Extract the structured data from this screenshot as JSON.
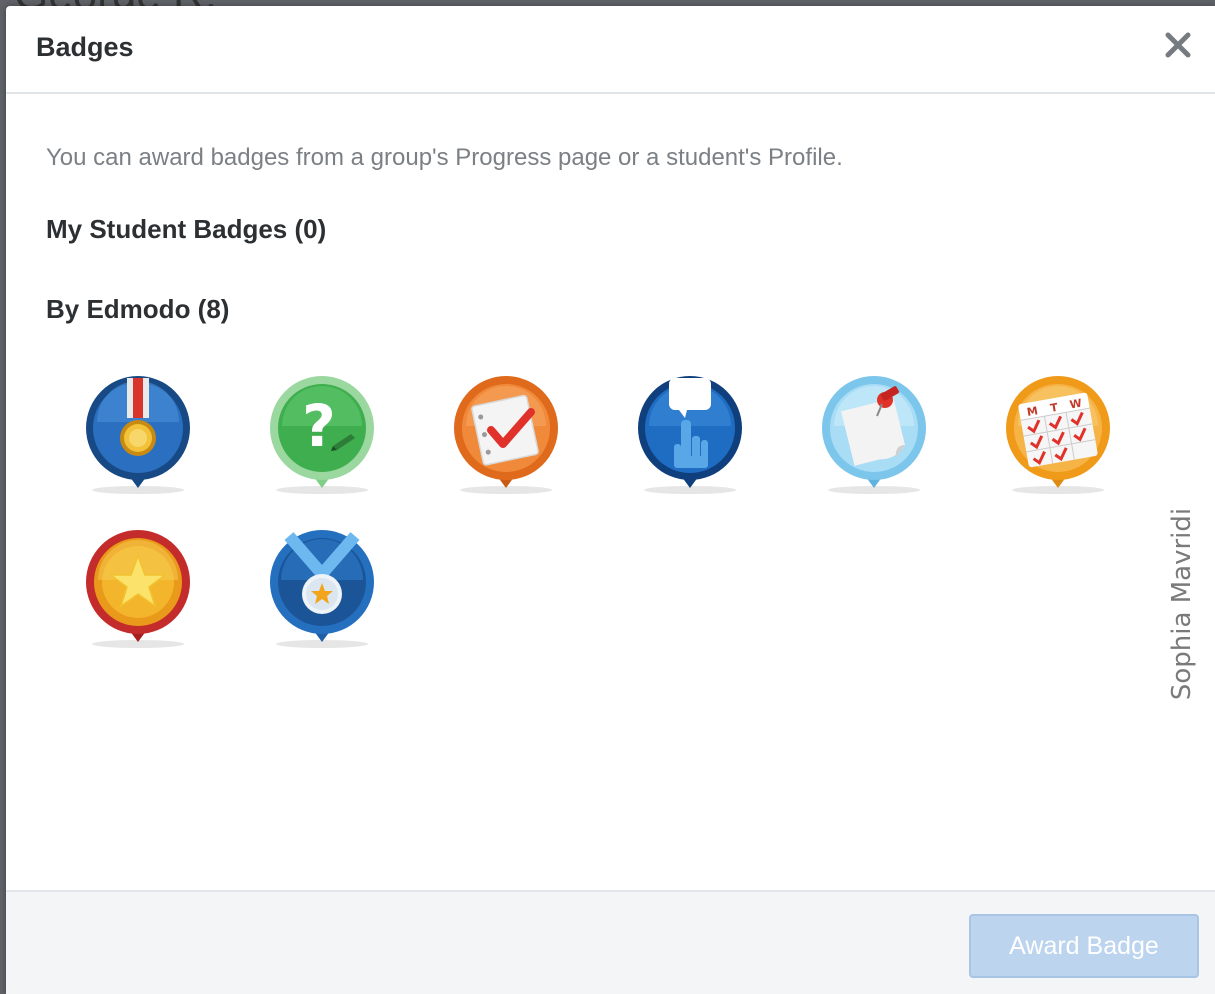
{
  "background_title": "George R.",
  "modal": {
    "title": "Badges",
    "close_icon": "close-icon",
    "intro_text": "You can award badges from a group's Progress page or a student's Profile.",
    "sections": [
      {
        "heading": "My Student Badges (0)"
      },
      {
        "heading": "By Edmodo (8)"
      }
    ],
    "badges": [
      {
        "icon": "medal-ribbon-badge-icon",
        "color": "#1f5fa8"
      },
      {
        "icon": "question-mark-badge-icon",
        "color": "#4cbb5a"
      },
      {
        "icon": "checklist-badge-icon",
        "color": "#e8711f"
      },
      {
        "icon": "raised-hand-badge-icon",
        "color": "#1b63b3"
      },
      {
        "icon": "pinned-note-badge-icon",
        "color": "#6cc0ea"
      },
      {
        "icon": "calendar-badge-icon",
        "color": "#f3a11b"
      },
      {
        "icon": "star-badge-icon",
        "color": "#c42b2b"
      },
      {
        "icon": "star-medal-badge-icon",
        "color": "#2470bf"
      }
    ],
    "calendar_days": [
      "M",
      "T",
      "W"
    ],
    "footer": {
      "award_button_label": "Award Badge",
      "award_button_color": "#bcd4ee"
    }
  },
  "watermark": "Sophia Mavridi"
}
